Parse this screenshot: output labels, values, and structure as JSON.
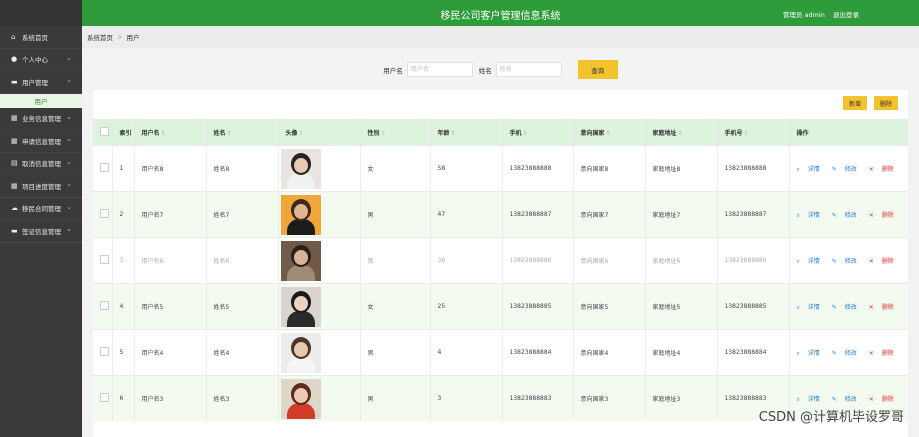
{
  "app": {
    "title": "移民公司客户管理信息系统",
    "user": "管理员 admin",
    "logout": "退出登录"
  },
  "breadcrumb": {
    "home": "系统首页",
    "sep": ">",
    "current": "用户"
  },
  "sidebar": {
    "items": [
      {
        "label": "系统首页",
        "icon": "home-icon",
        "chevron": false
      },
      {
        "label": "个人中心",
        "icon": "user-icon",
        "chevron": true
      },
      {
        "label": "用户管理",
        "icon": "monitor-icon",
        "chevron": true
      },
      {
        "label": "业务信息管理",
        "icon": "grid-icon",
        "chevron": true
      },
      {
        "label": "申请信息管理",
        "icon": "grid-icon",
        "chevron": true
      },
      {
        "label": "取消信息管理",
        "icon": "doc-icon",
        "chevron": true
      },
      {
        "label": "项目进度管理",
        "icon": "grid-icon",
        "chevron": true
      },
      {
        "label": "移民合同管理",
        "icon": "cloud-icon",
        "chevron": true
      },
      {
        "label": "签证信息管理",
        "icon": "monitor-icon",
        "chevron": true
      }
    ],
    "sub": "用户"
  },
  "search": {
    "username_label": "用户名",
    "username_placeholder": "用户名",
    "name_label": "姓名",
    "name_placeholder": "姓名",
    "query_button": "查询"
  },
  "actions": {
    "add": "新增",
    "delete": "删除"
  },
  "table": {
    "headers": [
      "索引",
      "用户名",
      "姓名",
      "头像",
      "性别",
      "年龄",
      "手机",
      "意向国家",
      "家庭地址",
      "手机号",
      "操作"
    ],
    "rows": [
      {
        "index": "1",
        "username": "用户名8",
        "name": "姓名8",
        "gender": "女",
        "age": "58",
        "phone": "13823888888",
        "country": "意向国家8",
        "address": "家庭地址8",
        "mobile": "13823888888"
      },
      {
        "index": "2",
        "username": "用户名7",
        "name": "姓名7",
        "gender": "男",
        "age": "47",
        "phone": "13823888887",
        "country": "意向国家7",
        "address": "家庭地址7",
        "mobile": "13823888887"
      },
      {
        "index": "3",
        "username": "用户名6",
        "name": "姓名6",
        "gender": "男",
        "age": "36",
        "phone": "13823888886",
        "country": "意向国家6",
        "address": "家庭地址6",
        "mobile": "13823888886"
      },
      {
        "index": "4",
        "username": "用户名5",
        "name": "姓名5",
        "gender": "女",
        "age": "25",
        "phone": "13823888885",
        "country": "意向国家5",
        "address": "家庭地址5",
        "mobile": "13823888885"
      },
      {
        "index": "5",
        "username": "用户名4",
        "name": "姓名4",
        "gender": "男",
        "age": "4",
        "phone": "13823888884",
        "country": "意向国家4",
        "address": "家庭地址4",
        "mobile": "13823888884"
      },
      {
        "index": "6",
        "username": "用户名3",
        "name": "姓名3",
        "gender": "男",
        "age": "3",
        "phone": "13823888883",
        "country": "意向国家3",
        "address": "家庭地址3",
        "mobile": "13823888883"
      }
    ],
    "ops": {
      "detail": "详情",
      "edit": "修改",
      "del": "删除"
    }
  },
  "colors": {
    "green": "#2e9c3a",
    "yellow": "#f2c32a",
    "sidebar": "#3a3a3a"
  },
  "watermark": "CSDN @计算机毕设罗哥"
}
